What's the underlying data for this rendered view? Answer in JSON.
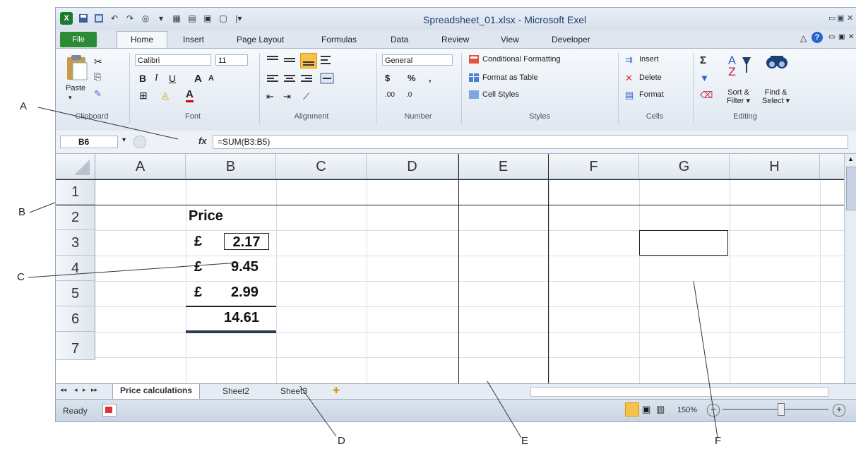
{
  "window": {
    "title": "Spreadsheet_01.xlsx - Microsoft Exel"
  },
  "tabs": [
    "File",
    "Home",
    "Insert",
    "Page Layout",
    "Formulas",
    "Data",
    "Review",
    "View",
    "Developer"
  ],
  "ribbon": {
    "clipboard": {
      "paste": "Paste",
      "label": "Clipboard"
    },
    "font": {
      "name": "Calibri",
      "size": "11",
      "bold": "B",
      "italic": "I",
      "underline": "U",
      "grow": "A",
      "shrink": "A",
      "label": "Font"
    },
    "alignment": {
      "label": "Alignment"
    },
    "number": {
      "format": "General",
      "currency": "$",
      "percent": "%",
      "comma": ",",
      "inc": ".00",
      "dec": ".0",
      "label": "Number"
    },
    "styles": {
      "conditional": "Conditional Formatting",
      "table": "Format as Table",
      "cell": "Cell Styles",
      "label": "Styles"
    },
    "cells": {
      "insert": "Insert",
      "delete": "Delete",
      "format": "Format",
      "label": "Cells"
    },
    "editing": {
      "sum": "Σ",
      "sort": "Sort &",
      "sort2": "Filter",
      "find": "Find &",
      "find2": "Select",
      "label": "Editing"
    }
  },
  "formula_bar": {
    "name_box": "B6",
    "fx": "fx",
    "formula": "=SUM(B3:B5)"
  },
  "columns": [
    "A",
    "B",
    "C",
    "D",
    "E",
    "F",
    "G",
    "H"
  ],
  "rows": [
    "1",
    "2",
    "3",
    "4",
    "5",
    "6",
    "7"
  ],
  "cells": {
    "b2": "Price",
    "b3_sym": "£",
    "b3_val": "2.17",
    "b4_sym": "£",
    "b4_val": "9.45",
    "b5_sym": "£",
    "b5_val": "2.99",
    "b6_val": "14.61"
  },
  "sheets": [
    "Price calculations",
    "Sheet2",
    "Sheet3"
  ],
  "status": {
    "ready": "Ready",
    "zoom": "150%"
  },
  "callouts": [
    "A",
    "B",
    "C",
    "D",
    "E",
    "F"
  ],
  "colors": {
    "file_tab": "#2e8b35",
    "title_text": "#1d3f72",
    "grid_line": "#d7dde5"
  }
}
